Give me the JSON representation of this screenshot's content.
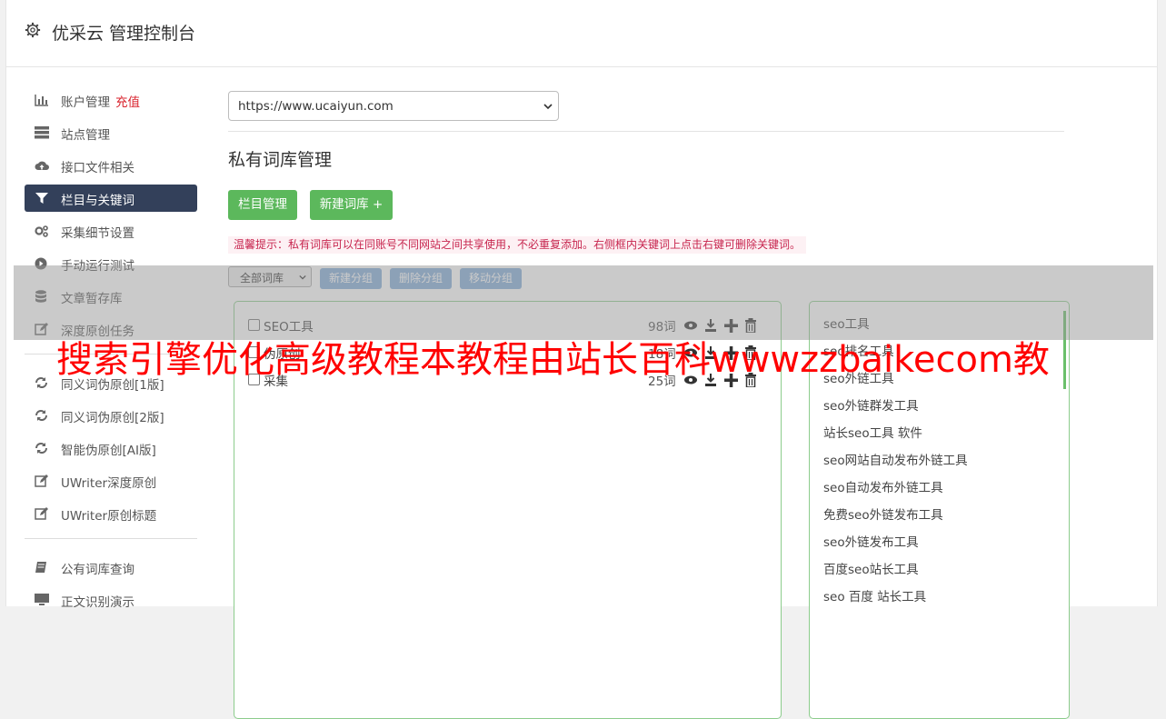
{
  "app": {
    "title": "优采云 管理控制台",
    "icon": "gear-icon"
  },
  "sidebar": {
    "items": [
      {
        "label": "账户管理",
        "extra": "充值",
        "icon": "bar-chart-icon"
      },
      {
        "label": "站点管理",
        "icon": "server-icon"
      },
      {
        "label": "接口文件相关",
        "icon": "cloud-upload-icon"
      },
      {
        "label": "栏目与关键词",
        "icon": "filter-icon",
        "active": true
      },
      {
        "label": "采集细节设置",
        "icon": "cogs-icon"
      },
      {
        "label": "手动运行测试",
        "icon": "play-circle-icon"
      },
      {
        "label": "文章暂存库",
        "icon": "database-icon"
      },
      {
        "label": "深度原创任务",
        "icon": "edit-icon"
      },
      {
        "label": "同义词伪原创[1版]",
        "icon": "refresh-icon"
      },
      {
        "label": "同义词伪原创[2版]",
        "icon": "refresh-icon"
      },
      {
        "label": "智能伪原创[AI版]",
        "icon": "refresh-icon"
      },
      {
        "label": "UWriter深度原创",
        "icon": "edit-icon"
      },
      {
        "label": "UWriter原创标题",
        "icon": "edit-icon"
      },
      {
        "label": "公有词库查询",
        "icon": "book-icon"
      },
      {
        "label": "正文识别演示",
        "icon": "monitor-icon"
      }
    ]
  },
  "main": {
    "site_select": "https://www.ucaiyun.com",
    "section_title": "私有词库管理",
    "buttons": {
      "column_manage": "栏目管理",
      "new_library": "新建词库 +"
    },
    "tip": "温馨提示：私有词库可以在同账号不同网站之间共享使用，不必重复添加。右侧框内关键词上点击右键可删除关键词。",
    "group_select": "全部词库",
    "group_buttons": {
      "new_group": "新建分组",
      "delete_group": "删除分组",
      "move_group": "移动分组"
    },
    "libraries": [
      {
        "name": "SEO工具",
        "count": "98词"
      },
      {
        "name": "伪原创",
        "count": "18词"
      },
      {
        "name": "采集",
        "count": "25词"
      }
    ],
    "keywords": [
      "seo工具",
      "seo排名工具",
      "seo外链工具",
      "seo外链群发工具",
      "站长seo工具 软件",
      "seo网站自动发布外链工具",
      "seo自动发布外链工具",
      "免费seo外链发布工具",
      "seo外链发布工具",
      "百度seo站长工具",
      "seo 百度 站长工具"
    ]
  },
  "watermark": "搜索引擎优化高级教程本教程由站长百科wwwzzbaikecom教",
  "colors": {
    "active_nav": "#33405a",
    "green": "#5cb85c",
    "blue": "#83acd8",
    "tip_text": "#c7254e",
    "watermark": "#ff0000"
  }
}
